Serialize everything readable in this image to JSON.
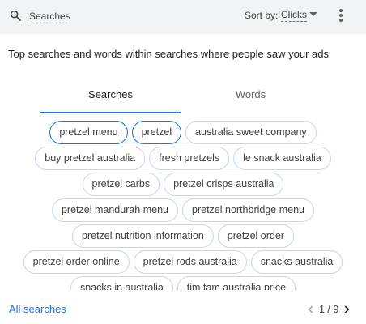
{
  "header": {
    "search_label": "Searches",
    "sort_prefix": "Sort by:",
    "sort_value": "Clicks"
  },
  "heading": "Top searches and words within searches where people saw your ads",
  "tabs": [
    {
      "label": "Searches",
      "active": true
    },
    {
      "label": "Words",
      "active": false
    }
  ],
  "chips": [
    [
      "pretzel menu",
      "pretzel",
      "australia sweet company"
    ],
    [
      "buy pretzel australia",
      "fresh pretzels",
      "le snack australia"
    ],
    [
      "pretzel carbs",
      "pretzel crisps australia"
    ],
    [
      "pretzel mandurah menu",
      "pretzel northbridge menu"
    ],
    [
      "pretzel nutrition information",
      "pretzel order"
    ],
    [
      "pretzel order online",
      "pretzel rods australia",
      "snacks australia"
    ],
    [
      "snacks in australia",
      "tim tam australia price"
    ]
  ],
  "selected_chips": [
    "pretzel menu",
    "pretzel"
  ],
  "footer": {
    "all_searches": "All searches",
    "page": "1 / 9"
  },
  "colors": {
    "accent": "#1a73e8",
    "chip_border": "#c7d7ee",
    "topbar_bg": "#f1f3f4"
  }
}
